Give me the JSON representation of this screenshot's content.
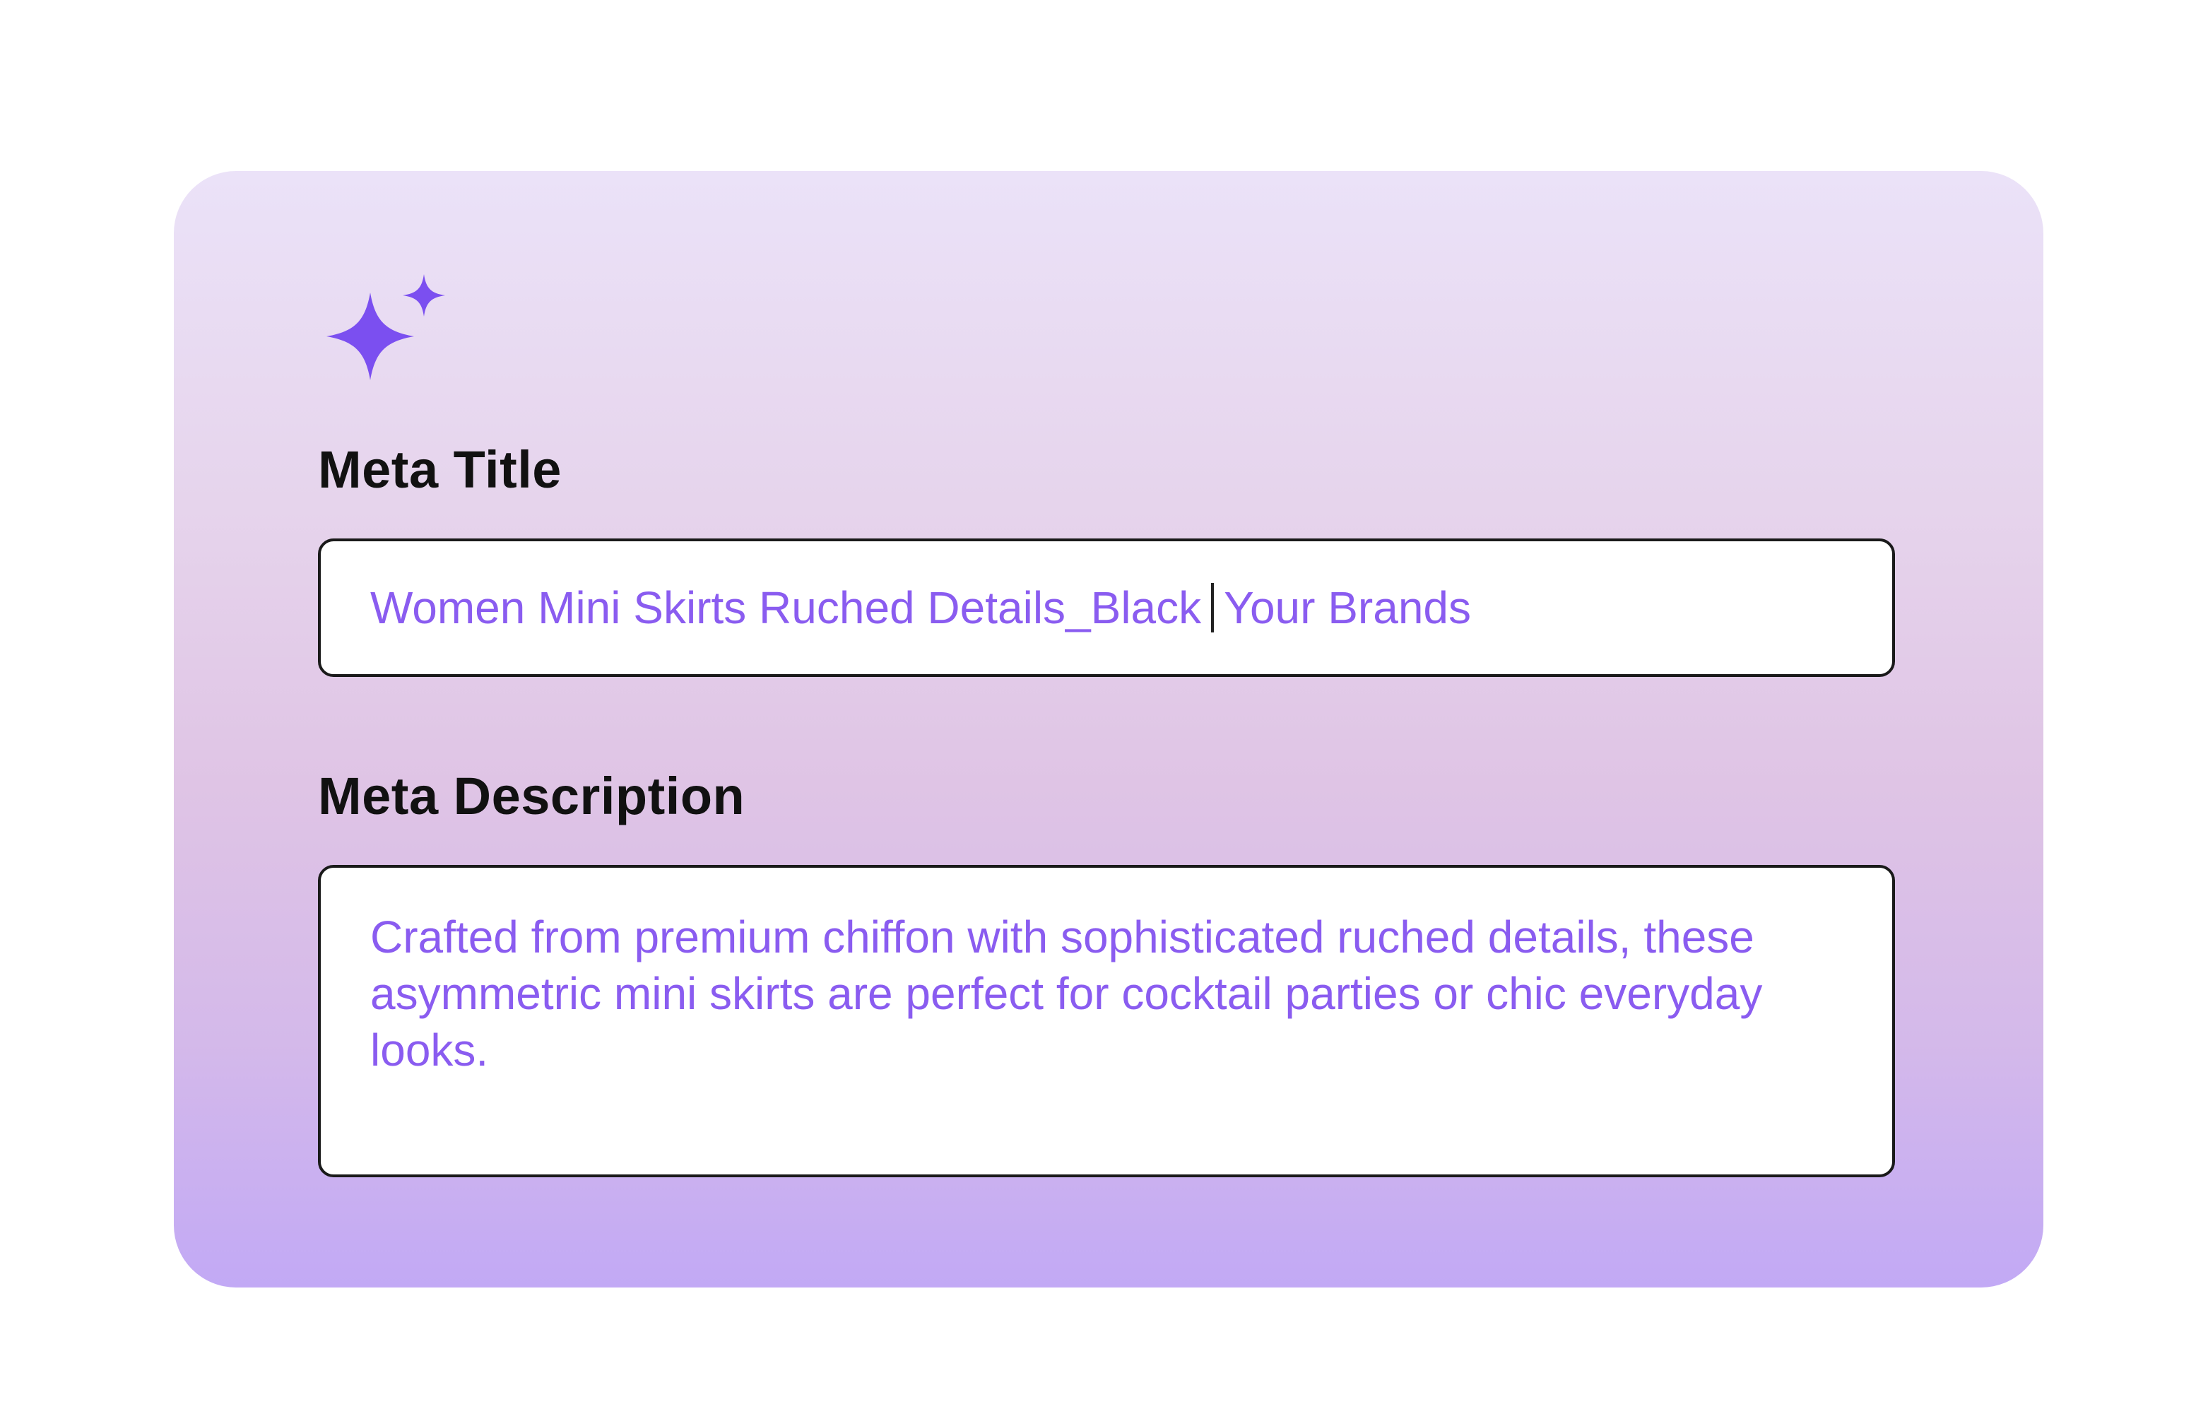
{
  "icon": "sparkle-icon",
  "colors": {
    "accent": "#8a5cf0",
    "icon": "#7b4ff0",
    "label": "#111111"
  },
  "meta_title": {
    "label": "Meta Title",
    "value_before_caret": "Women Mini Skirts Ruched Details_Black",
    "value_after_caret": "Your Brands"
  },
  "meta_description": {
    "label": "Meta Description",
    "value": "Crafted from premium chiffon with sophisticated ruched details, these asymmetric mini skirts are perfect for cocktail parties or chic everyday looks."
  }
}
